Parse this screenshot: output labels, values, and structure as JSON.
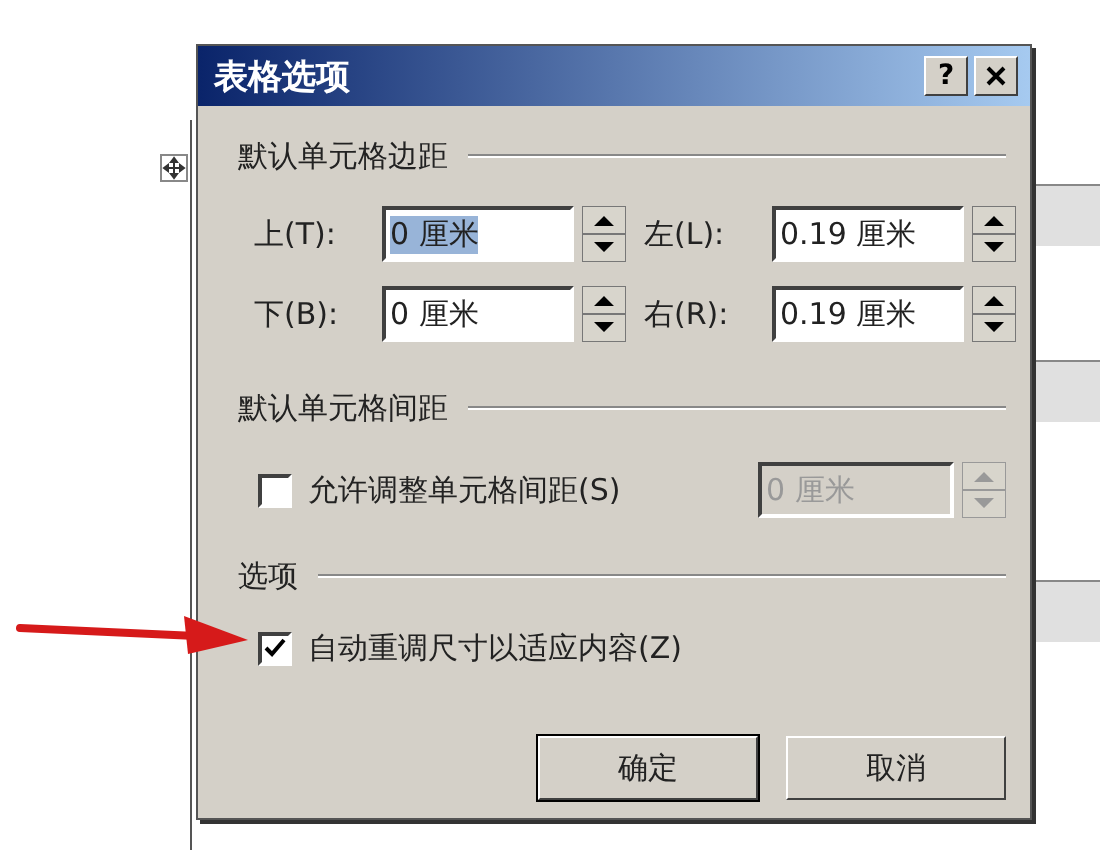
{
  "window": {
    "title": "表格选项",
    "help_button": "?"
  },
  "margins": {
    "heading": "默认单元格边距",
    "fields": [
      {
        "label": "上(T):",
        "value": "0 厘米",
        "text_selected": true
      },
      {
        "label": "左(L):",
        "value": "0.19 厘米",
        "text_selected": false
      },
      {
        "label": "下(B):",
        "value": "0 厘米",
        "text_selected": false
      },
      {
        "label": "右(R):",
        "value": "0.19 厘米",
        "text_selected": false
      }
    ]
  },
  "spacing": {
    "heading": "默认单元格间距",
    "checkbox": {
      "label": "允许调整单元格间距(S)",
      "checked": false
    },
    "field": {
      "value": "0 厘米",
      "disabled": true
    }
  },
  "options": {
    "heading": "选项",
    "checkbox": {
      "label": "自动重调尺寸以适应内容(Z)",
      "checked": true
    }
  },
  "buttons": [
    {
      "label": "确定",
      "default": true
    },
    {
      "label": "取消",
      "default": false
    }
  ]
}
